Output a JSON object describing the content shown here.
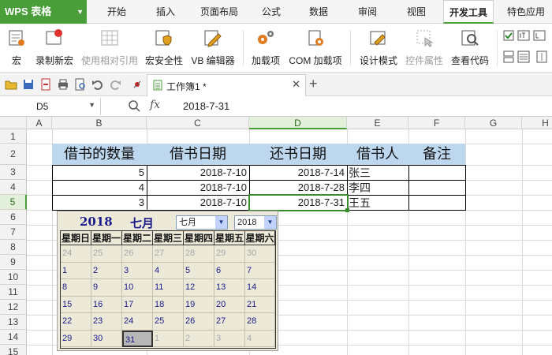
{
  "app": {
    "logo": "WPS 表格",
    "menu_tabs": [
      "开始",
      "插入",
      "页面布局",
      "公式",
      "数据",
      "审阅",
      "视图",
      "开发工具",
      "特色应用"
    ],
    "active_tab": "开发工具"
  },
  "ribbon": {
    "macro": "宏",
    "record": "录制新宏",
    "relative": "使用相对引用",
    "security": "宏安全性",
    "vb_editor": "VB 编辑器",
    "addins": "加载项",
    "com_addins": "COM 加载项",
    "design_mode": "设计模式",
    "control_props": "控件属性",
    "view_code": "查看代码"
  },
  "document": {
    "tab_title": "工作簿1 *"
  },
  "formula_bar": {
    "cell_ref": "D5",
    "fx": "fx",
    "value": "2018-7-31"
  },
  "sheet": {
    "columns": [
      "A",
      "B",
      "C",
      "D",
      "E",
      "F",
      "G",
      "H"
    ],
    "rows": [
      "1",
      "2",
      "3",
      "4",
      "5",
      "6",
      "7",
      "8",
      "9",
      "10",
      "11",
      "12",
      "13",
      "14",
      "15"
    ],
    "headers": [
      "借书的数量",
      "借书日期",
      "还书日期",
      "借书人",
      "备注"
    ],
    "data": [
      [
        "5",
        "2018-7-10",
        "2018-7-14",
        "张三",
        ""
      ],
      [
        "4",
        "2018-7-10",
        "2018-7-28",
        "李四",
        ""
      ],
      [
        "3",
        "2018-7-10",
        "2018-7-31",
        "王五",
        ""
      ]
    ]
  },
  "calendar": {
    "year_label": "2018",
    "month_label": "七月",
    "month_select": "七月",
    "year_select": "2018",
    "weekdays": [
      "星期日",
      "星期一",
      "星期二",
      "星期三",
      "星期四",
      "星期五",
      "星期六"
    ],
    "weeks": [
      [
        "24",
        "25",
        "26",
        "27",
        "28",
        "29",
        "30"
      ],
      [
        "1",
        "2",
        "3",
        "4",
        "5",
        "6",
        "7"
      ],
      [
        "8",
        "9",
        "10",
        "11",
        "12",
        "13",
        "14"
      ],
      [
        "15",
        "16",
        "17",
        "18",
        "19",
        "20",
        "21"
      ],
      [
        "22",
        "23",
        "24",
        "25",
        "26",
        "27",
        "28"
      ],
      [
        "29",
        "30",
        "31",
        "1",
        "2",
        "3",
        "4"
      ]
    ],
    "other_month": [
      [
        true,
        true,
        true,
        true,
        true,
        true,
        true
      ],
      [
        false,
        false,
        false,
        false,
        false,
        false,
        false
      ],
      [
        false,
        false,
        false,
        false,
        false,
        false,
        false
      ],
      [
        false,
        false,
        false,
        false,
        false,
        false,
        false
      ],
      [
        false,
        false,
        false,
        false,
        false,
        false,
        false
      ],
      [
        false,
        false,
        false,
        true,
        true,
        true,
        true
      ]
    ],
    "selected_day": "31"
  },
  "colors": {
    "accent": "#4a9e3a",
    "header_fill": "#bdd7ee"
  }
}
